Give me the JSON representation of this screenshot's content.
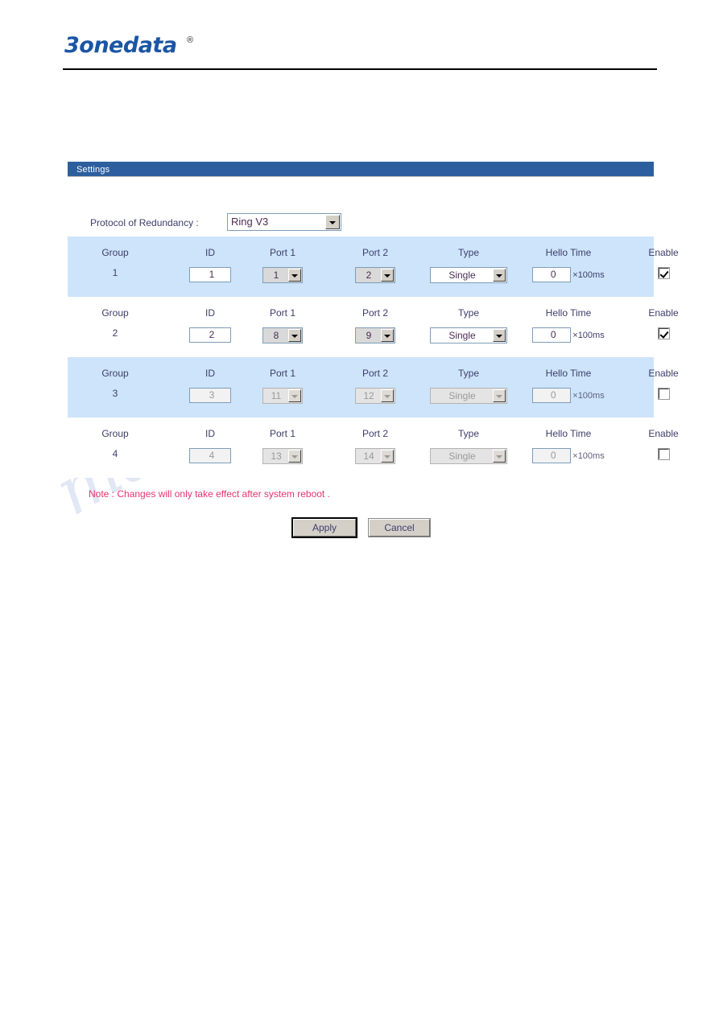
{
  "header": {
    "brand": "3onedata",
    "registered_mark": "®"
  },
  "panel": {
    "title": "Settings"
  },
  "protocol": {
    "label": "Protocol of Redundancy :",
    "value": "Ring V3",
    "options": [
      "Ring V3"
    ]
  },
  "columns": {
    "group": "Group",
    "id": "ID",
    "port1": "Port 1",
    "port2": "Port 2",
    "type": "Type",
    "hello": "Hello Time",
    "enable": "Enable"
  },
  "hello_unit": "×100ms",
  "rows": [
    {
      "group": "1",
      "id": "1",
      "port1": "1",
      "port2": "2",
      "type": "Single",
      "hello": "0",
      "unit": "×100ms",
      "enabled": true
    },
    {
      "group": "2",
      "id": "2",
      "port1": "8",
      "port2": "9",
      "type": "Single",
      "hello": "0",
      "unit": "×100ms",
      "enabled": true
    },
    {
      "group": "3",
      "id": "3",
      "port1": "11",
      "port2": "12",
      "type": "Single",
      "hello": "0",
      "unit": "×100ms",
      "enabled": false
    },
    {
      "group": "4",
      "id": "4",
      "port1": "13",
      "port2": "14",
      "type": "Single",
      "hello": "0",
      "unit": "×100ms",
      "enabled": false
    }
  ],
  "note": "Note : Changes will only take effect after system reboot .",
  "buttons": {
    "apply": "Apply",
    "cancel": "Cancel"
  },
  "watermark": "manualshive.com",
  "colors": {
    "titlebar_blue": "#2d5f9e",
    "row_shaded_blue": "#cde4fa",
    "label_text": "#3d3d6b",
    "note_red": "#e8336d",
    "brand_blue": "#1b55a5"
  }
}
